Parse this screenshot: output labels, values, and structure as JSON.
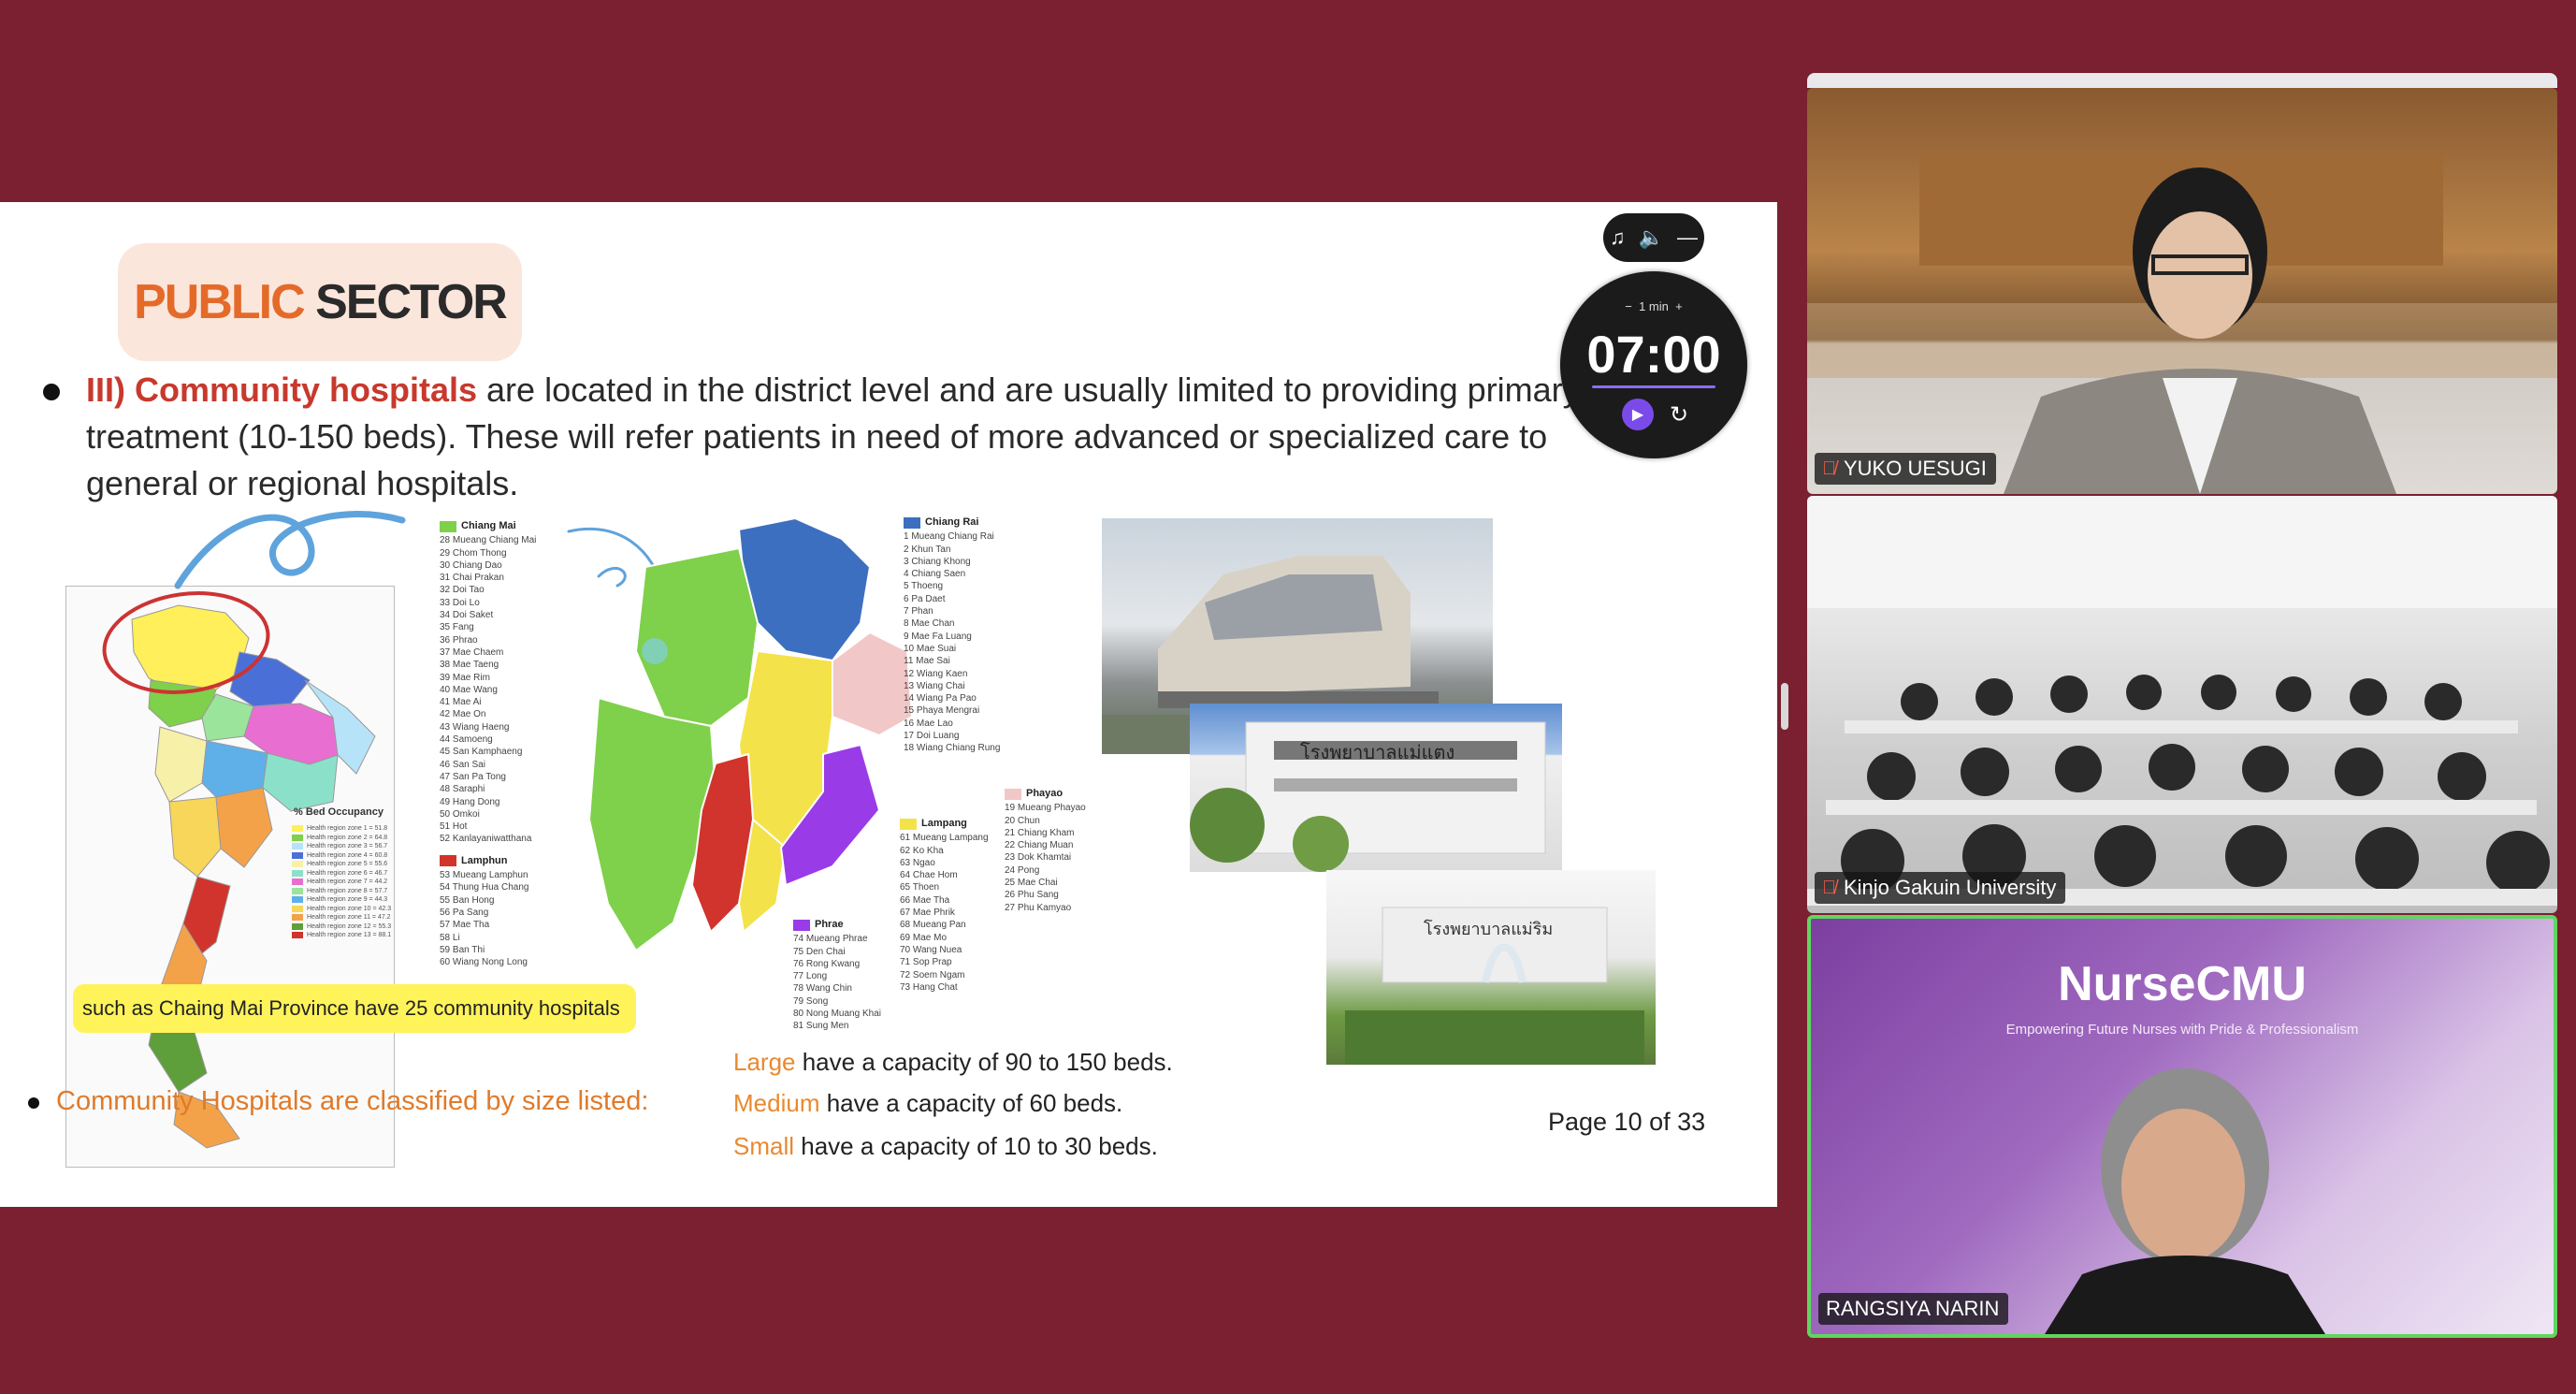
{
  "slide": {
    "sector": {
      "accent": "PUBLIC",
      "rest": " SECTOR"
    },
    "paragraph": {
      "highlight": "III) Community hospitals",
      "text": " are located in the district level and are usually limited to providing primary care treatment (10-150 beds). These will refer patients in need of more advanced or specialized care to general or regional hospitals."
    },
    "small_map": {
      "legend_title": "% Bed Occupancy",
      "legend_rows": [
        {
          "label": "Health region zone 1 = 51.8",
          "color": "#ffef5a"
        },
        {
          "label": "Health region zone 2 = 64.8",
          "color": "#7fd04a"
        },
        {
          "label": "Health region zone 3 = 56.7",
          "color": "#b6e3f7"
        },
        {
          "label": "Health region zone 4 = 60.8",
          "color": "#4a70d8"
        },
        {
          "label": "Health region zone 5 = 55.6",
          "color": "#f7f0a8"
        },
        {
          "label": "Health region zone 6 = 46.7",
          "color": "#8be0c9"
        },
        {
          "label": "Health region zone 7 = 44.2",
          "color": "#e86fd1"
        },
        {
          "label": "Health region zone 8 = 57.7",
          "color": "#9be49b"
        },
        {
          "label": "Health region zone 9 = 44.3",
          "color": "#5fb0e8"
        },
        {
          "label": "Health region zone 10 = 42.3",
          "color": "#f7d65a"
        },
        {
          "label": "Health region zone 11 = 47.2",
          "color": "#f3a24a"
        },
        {
          "label": "Health region zone 12 = 55.3",
          "color": "#5e9e3b"
        },
        {
          "label": "Health region zone 13 = 88.1",
          "color": "#d0342c"
        }
      ]
    },
    "districts": {
      "chiang_mai": {
        "name": "Chiang Mai",
        "items": [
          "28 Mueang Chiang Mai",
          "29 Chom Thong",
          "30 Chiang Dao",
          "31 Chai Prakan",
          "32 Doi Tao",
          "33 Doi Lo",
          "34 Doi Saket",
          "35 Fang",
          "36 Phrao",
          "37 Mae Chaem",
          "38 Mae Taeng",
          "39 Mae Rim",
          "40 Mae Wang",
          "41 Mae Ai",
          "42 Mae On",
          "43 Wiang Haeng",
          "44 Samoeng",
          "45 San Kamphaeng",
          "46 San Sai",
          "47 San Pa Tong",
          "48 Saraphi",
          "49 Hang Dong",
          "50 Omkoi",
          "51 Hot",
          "52 Kanlayaniwatthana"
        ]
      },
      "lamphun": {
        "name": "Lamphun",
        "items": [
          "53 Mueang Lamphun",
          "54 Thung Hua Chang",
          "55 Ban Hong",
          "56 Pa Sang",
          "57 Mae Tha",
          "58 Li",
          "59 Ban Thi",
          "60 Wiang Nong Long"
        ]
      },
      "chiang_rai": {
        "name": "Chiang Rai",
        "items": [
          "1 Mueang Chiang Rai",
          "2 Khun Tan",
          "3 Chiang Khong",
          "4 Chiang Saen",
          "5 Thoeng",
          "6 Pa Daet",
          "7 Phan",
          "8 Mae Chan",
          "9 Mae Fa Luang",
          "10 Mae Suai",
          "11 Mae Sai",
          "12 Wiang Kaen",
          "13 Wiang Chai",
          "14 Wiang Pa Pao",
          "15 Phaya Mengrai",
          "16 Mae Lao",
          "17 Doi Luang",
          "18 Wiang Chiang Rung"
        ]
      },
      "lampang": {
        "name": "Lampang",
        "items": [
          "61 Mueang Lampang",
          "62 Ko Kha",
          "63 Ngao",
          "64 Chae Hom",
          "65 Thoen",
          "66 Mae Tha",
          "67 Mae Phrik",
          "68 Mueang Pan",
          "69 Mae Mo",
          "70 Wang Nuea",
          "71 Sop Prap",
          "72 Soem Ngam",
          "73 Hang Chat"
        ]
      },
      "phayao": {
        "name": "Phayao",
        "items": [
          "19 Mueang Phayao",
          "20 Chun",
          "21 Chiang Kham",
          "22 Chiang Muan",
          "23 Dok Khamtai",
          "24 Pong",
          "25 Mae Chai",
          "26 Phu Sang",
          "27 Phu Kamyao"
        ]
      },
      "phrae": {
        "name": "Phrae",
        "items": [
          "74 Mueang Phrae",
          "75 Den Chai",
          "76 Rong Kwang",
          "77 Long",
          "78 Wang Chin",
          "79 Song",
          "80 Nong Muang Khai",
          "81 Sung Men"
        ]
      }
    },
    "callout": "such as Chaing Mai  Province have 25 community hospitals",
    "classify": "Community Hospitals are classified by size listed:",
    "sizes": [
      {
        "kw": "Large",
        "rest": " have a capacity of 90 to 150 beds."
      },
      {
        "kw": "Medium",
        "rest": " have a capacity of 60 beds."
      },
      {
        "kw": "Small",
        "rest": " have a capacity of 10 to 30 beds."
      }
    ],
    "page": "Page 10 of 33",
    "photo_signs": [
      "โรงพยาบาลแม่แตง",
      "โรงพยาบาลแม่ริม"
    ]
  },
  "timer": {
    "step_minus": "−",
    "step_label": "1 min",
    "step_plus": "+",
    "time": "07:00"
  },
  "participants": [
    {
      "name": "YUKO UESUGI",
      "muted": true
    },
    {
      "name": "Kinjo Gakuin University",
      "muted": true
    },
    {
      "name": "RANGSIYA NARIN",
      "muted": false
    }
  ],
  "nursecmu": {
    "title": "NurseCMU",
    "tagline": "Empowering Future Nurses with Pride & Professionalism"
  },
  "colors": {
    "background": "#7a2030",
    "accent_orange": "#e46a2a",
    "highlight_red": "#c8392d",
    "callout_yellow": "#fff35a",
    "active_speaker": "#5fd65f"
  }
}
